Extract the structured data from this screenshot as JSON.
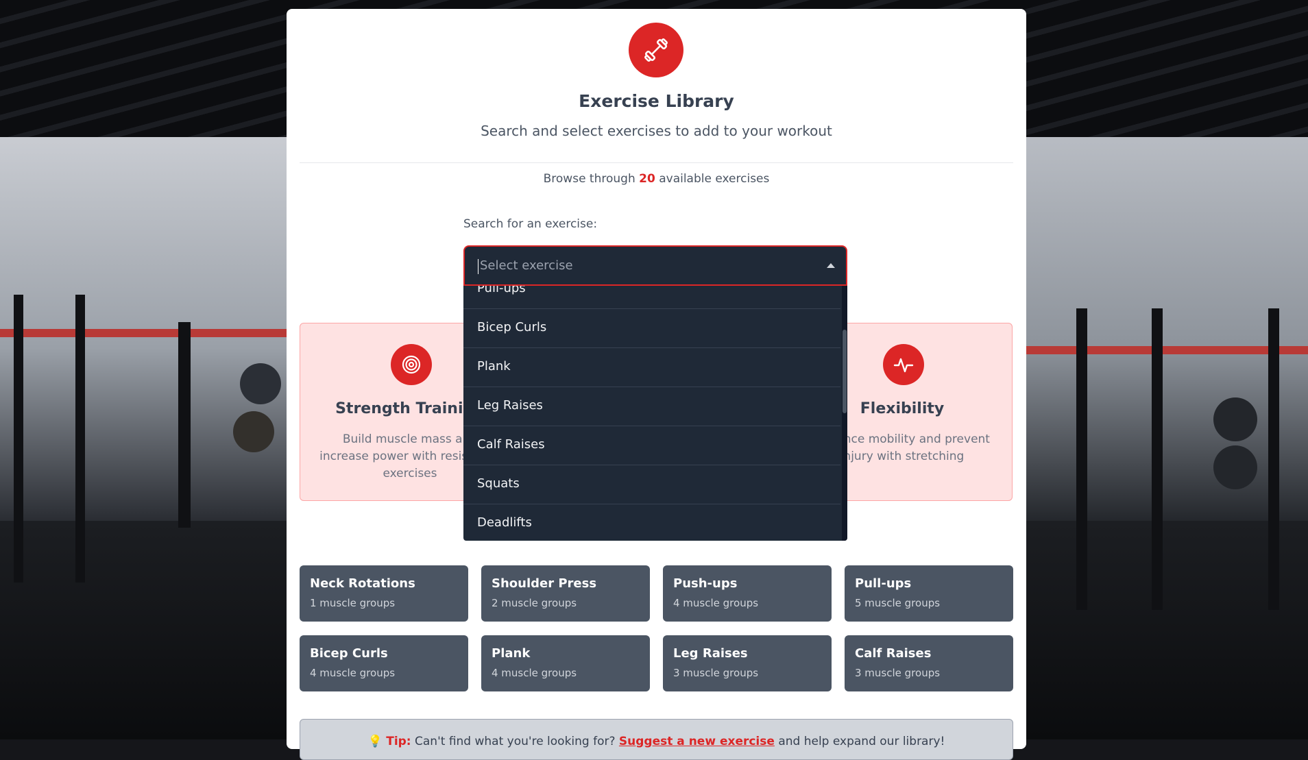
{
  "header": {
    "title": "Exercise Library",
    "subtitle": "Search and select exercises to add to your workout"
  },
  "browse": {
    "prefix": "Browse through",
    "count": "20",
    "suffix": "available exercises"
  },
  "search": {
    "label": "Search for an exercise:",
    "placeholder": "Select exercise"
  },
  "dropdown": {
    "items": [
      "Pull-ups",
      "Bicep Curls",
      "Plank",
      "Leg Raises",
      "Calf Raises",
      "Squats",
      "Deadlifts"
    ]
  },
  "features": [
    {
      "title": "Strength Training",
      "description": "Build muscle mass and increase power with resistance exercises",
      "icon": "target-icon"
    },
    {
      "title": "",
      "description": "",
      "icon": ""
    },
    {
      "title": "Flexibility",
      "description": "Enhance mobility and prevent injury with stretching",
      "icon": "activity-icon"
    }
  ],
  "exercises": [
    {
      "name": "Neck Rotations",
      "groups": "1 muscle groups"
    },
    {
      "name": "Shoulder Press",
      "groups": "2 muscle groups"
    },
    {
      "name": "Push-ups",
      "groups": "4 muscle groups"
    },
    {
      "name": "Pull-ups",
      "groups": "5 muscle groups"
    },
    {
      "name": "Bicep Curls",
      "groups": "4 muscle groups"
    },
    {
      "name": "Plank",
      "groups": "4 muscle groups"
    },
    {
      "name": "Leg Raises",
      "groups": "3 muscle groups"
    },
    {
      "name": "Calf Raises",
      "groups": "3 muscle groups"
    }
  ],
  "tip": {
    "label": "Tip:",
    "text": "Can't find what you're looking for?",
    "link": "Suggest a new exercise",
    "suffix": "and help expand our library!"
  },
  "colors": {
    "accent": "#dc2626",
    "card_bg": "#4b5563",
    "select_bg": "#1f2937"
  }
}
